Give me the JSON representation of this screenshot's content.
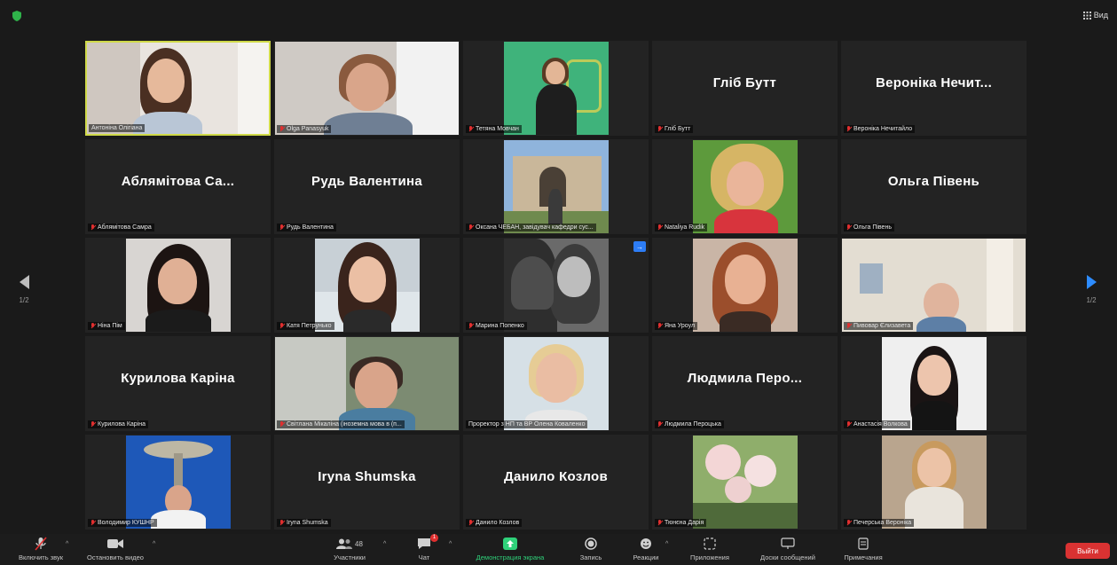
{
  "top": {
    "view_label": "Вид"
  },
  "tiles": [
    {
      "name": "Антоніна Олігіана",
      "muted": false,
      "active": true
    },
    {
      "name": "Olga Panasyuk",
      "muted": true
    },
    {
      "name": "Тетяна Мовчан",
      "muted": true
    },
    {
      "name": "Гліб Бутт",
      "muted": true,
      "big": "Гліб Бутт"
    },
    {
      "name": "Вероніка Нечитайло",
      "muted": true,
      "big": "Вероніка Нечит..."
    },
    {
      "name": "Аблямітова Самра",
      "muted": true,
      "big": "Аблямітова Са..."
    },
    {
      "name": "Рудь Валентина",
      "muted": true,
      "big": "Рудь Валентина"
    },
    {
      "name": "Оксана ЧЕБАН, завідувач кафедри сус...",
      "muted": true
    },
    {
      "name": "Nataliya Rudik",
      "muted": true
    },
    {
      "name": "Ольга Півень",
      "muted": true,
      "big": "Ольга Півень"
    },
    {
      "name": "Ніна Пім",
      "muted": true
    },
    {
      "name": "Катя Петрунько",
      "muted": true
    },
    {
      "name": "Марина Попенко",
      "muted": true,
      "pin": "→"
    },
    {
      "name": "Яна Уроул",
      "muted": true
    },
    {
      "name": "Пивовар Єлизавета",
      "muted": true
    },
    {
      "name": "Курилова Каріна",
      "muted": true,
      "big": "Курилова Каріна"
    },
    {
      "name": "Світлана Мікаліна (іноземна мова в (п...",
      "muted": true
    },
    {
      "name": "Проректор з НП та ВР Олена Коваленко",
      "muted": false
    },
    {
      "name": "Людмила Пероцька",
      "muted": true,
      "big": "Людмила Перо..."
    },
    {
      "name": "Анастасія Волкова",
      "muted": true
    },
    {
      "name": "Володимир КУШНР",
      "muted": true
    },
    {
      "name": "Iryna Shumska",
      "muted": true,
      "big": "Iryna Shumska"
    },
    {
      "name": "Данило Козлов",
      "muted": true,
      "big": "Данило Козлов"
    },
    {
      "name": "Тюнєна Дарія",
      "muted": true
    },
    {
      "name": "Печерська Вероніка",
      "muted": true
    }
  ],
  "nav": {
    "left_page": "1/2",
    "right_page": "1/2"
  },
  "toolbar": {
    "audio": "Включить звук",
    "video": "Остановить видео",
    "participants": "Участники",
    "participants_count": "48",
    "chat": "Чат",
    "chat_badge": "1",
    "share": "Демонстрация экрана",
    "record": "Запись",
    "reactions": "Реакции",
    "apps": "Приложения",
    "whiteboard": "Доски сообщений",
    "notes": "Примечания",
    "leave": "Выйти"
  },
  "colors": {
    "share_green": "#2fd17a",
    "leave_red": "#d93232",
    "active_border": "#cfd948"
  }
}
